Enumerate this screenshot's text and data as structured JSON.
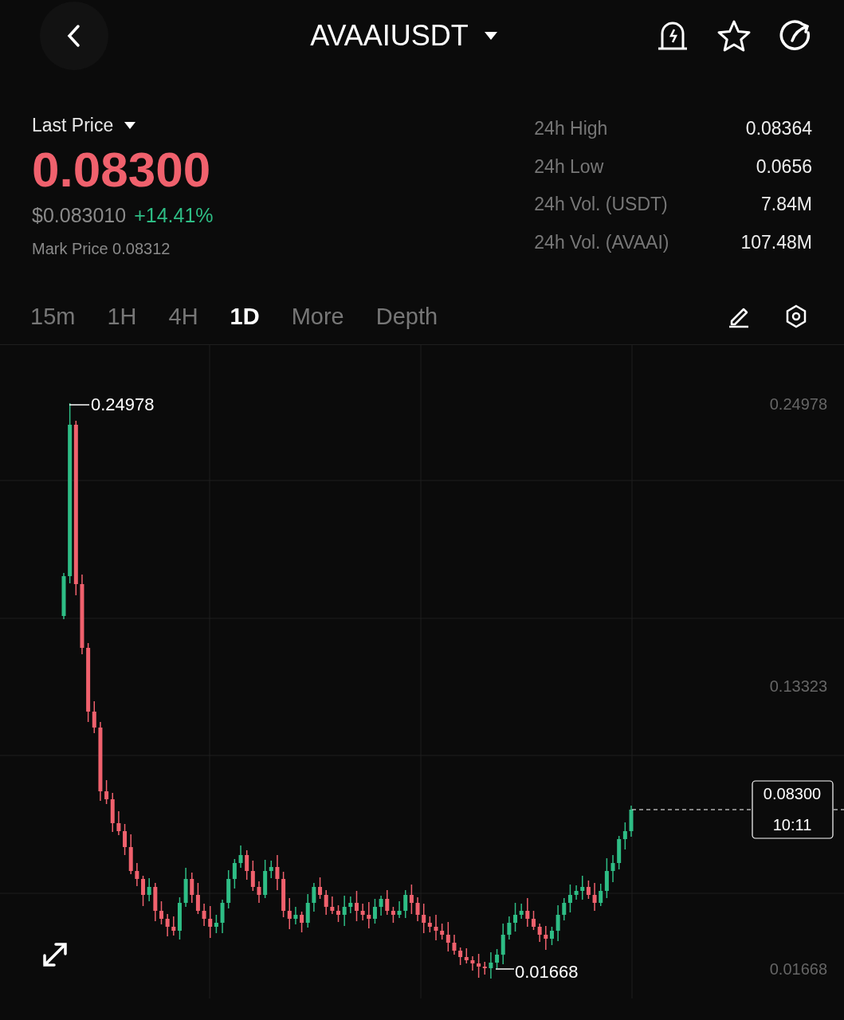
{
  "header": {
    "title": "AVAAIUSDT"
  },
  "price": {
    "label": "Last Price",
    "value": "0.08300",
    "usd": "$0.083010",
    "change": "+14.41%",
    "mark": "Mark Price 0.08312"
  },
  "stats": [
    {
      "label": "24h High",
      "value": "0.08364"
    },
    {
      "label": "24h Low",
      "value": "0.0656"
    },
    {
      "label": "24h Vol. (USDT)",
      "value": "7.84M"
    },
    {
      "label": "24h Vol. (AVAAI)",
      "value": "107.48M"
    }
  ],
  "tabs": [
    {
      "label": "15m",
      "selected": false
    },
    {
      "label": "1H",
      "selected": false
    },
    {
      "label": "4H",
      "selected": false
    },
    {
      "label": "1D",
      "selected": true
    },
    {
      "label": "More",
      "selected": false
    },
    {
      "label": "Depth",
      "selected": false
    }
  ],
  "chart": {
    "axis_labels": [
      "0.24978",
      "0.13323",
      "0.01668"
    ],
    "high_label": "0.24978",
    "low_label": "0.01668",
    "current_price": "0.08300",
    "countdown": "10:11"
  }
}
